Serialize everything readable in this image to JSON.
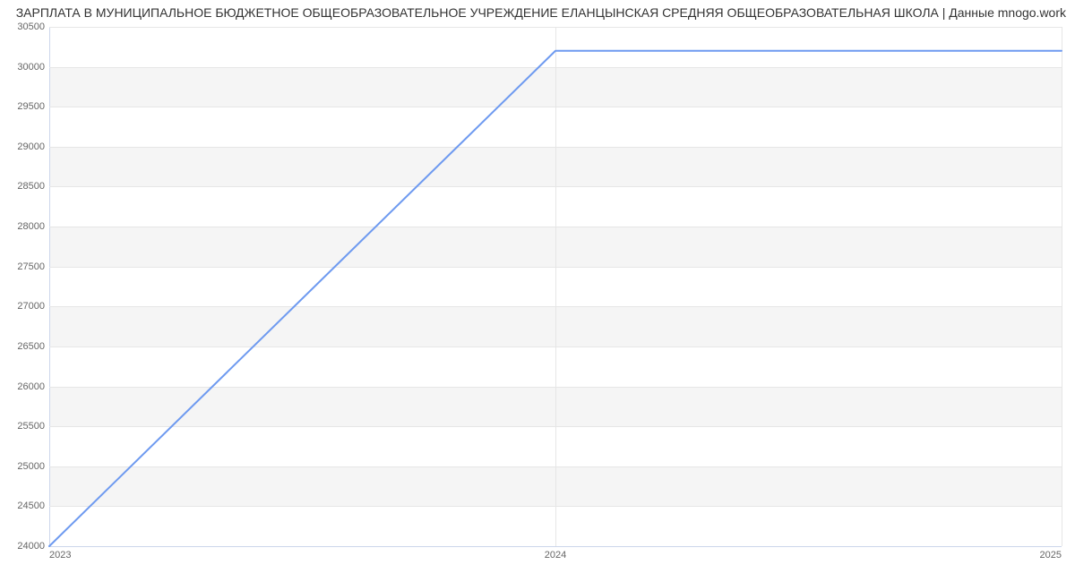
{
  "chart_data": {
    "type": "line",
    "title": "ЗАРПЛАТА В МУНИЦИПАЛЬНОЕ БЮДЖЕТНОЕ ОБЩЕОБРАЗОВАТЕЛЬНОЕ УЧРЕЖДЕНИЕ ЕЛАНЦЫНСКАЯ СРЕДНЯЯ ОБЩЕОБРАЗОВАТЕЛЬНАЯ ШКОЛА | Данные mnogo.work",
    "xlabel": "",
    "ylabel": "",
    "x": [
      2023,
      2024,
      2025
    ],
    "values": [
      24000,
      30200,
      30200
    ],
    "x_ticks": [
      2023,
      2024,
      2025
    ],
    "x_tick_labels": [
      "2023",
      "2024",
      "2025"
    ],
    "y_ticks": [
      24000,
      24500,
      25000,
      25500,
      26000,
      26500,
      27000,
      27500,
      28000,
      28500,
      29000,
      29500,
      30000,
      30500
    ],
    "y_tick_labels": [
      "24000",
      "24500",
      "25000",
      "25500",
      "26000",
      "26500",
      "27000",
      "27500",
      "28000",
      "28500",
      "29000",
      "29500",
      "30000",
      "30500"
    ],
    "xlim": [
      2023,
      2025
    ],
    "ylim": [
      24000,
      30500
    ],
    "grid": true,
    "line_color": "#6e9af0"
  }
}
